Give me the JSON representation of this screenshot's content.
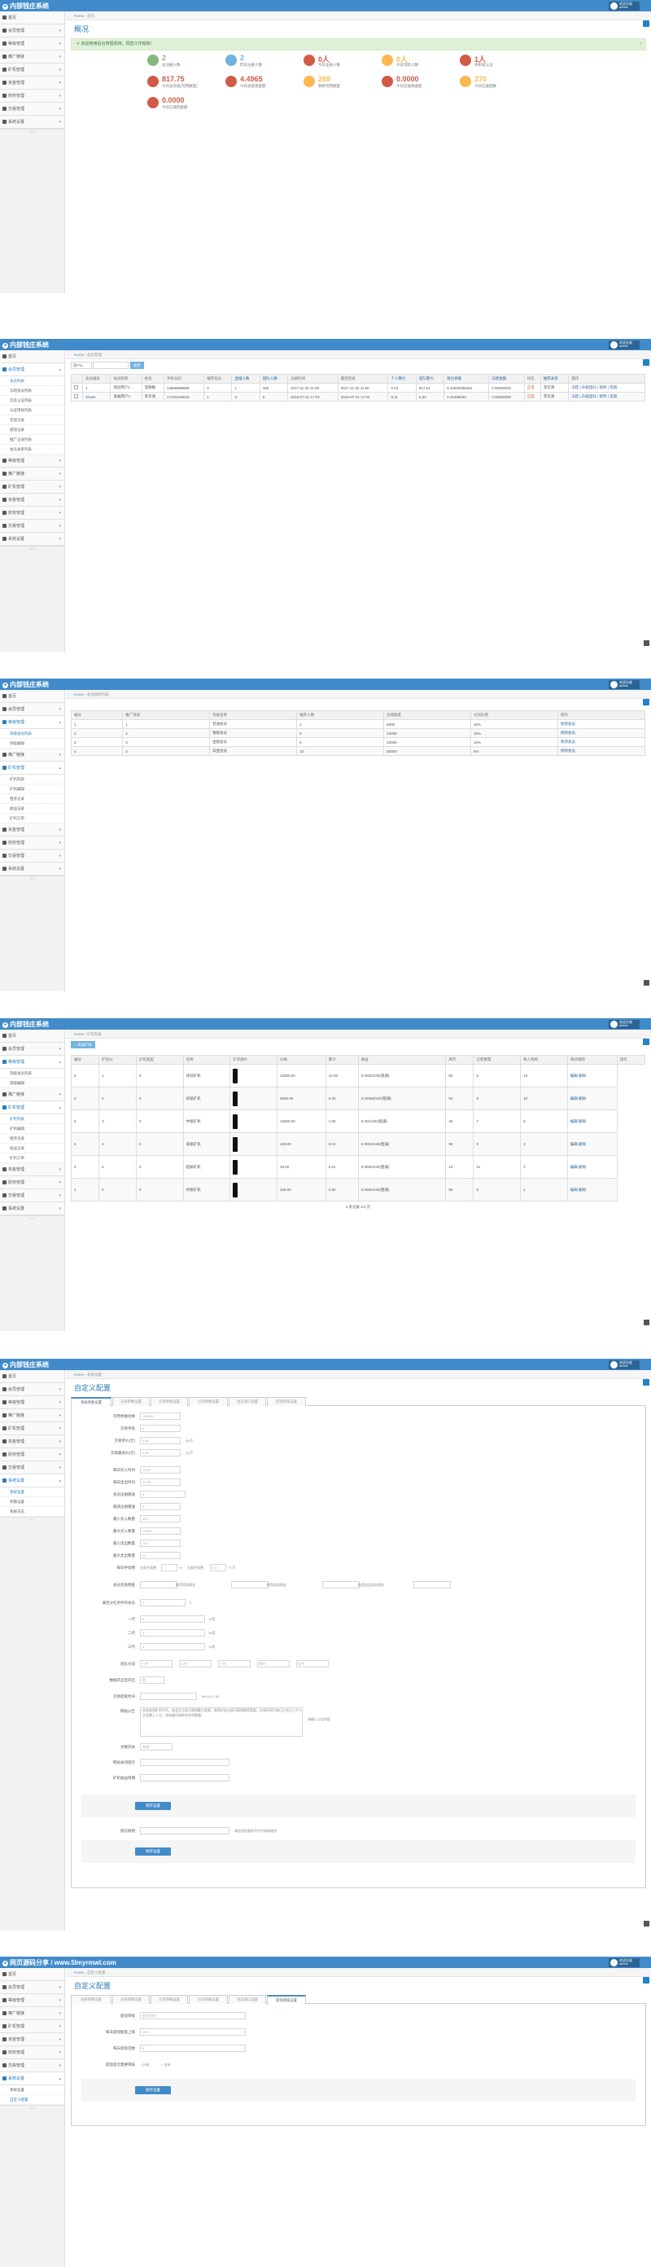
{
  "sys": {
    "title": "内部钱庄系统",
    "title_6": "网页源码分享 / www.5lmyrmwl.com",
    "user_line1": "欢迎光临",
    "user_line2": "admin",
    "collapse": "« »"
  },
  "crumb_home": "Home",
  "s1": {
    "crumb": "首页",
    "title": "概况",
    "alert": "欢迎使用后台管理系统，祝您工作愉快！",
    "stats": [
      {
        "value": "2",
        "label": "总注册人数",
        "color": "#87b87f"
      },
      {
        "value": "2",
        "label": "昨日注册人数",
        "color": "#6fb3e0"
      },
      {
        "value": "0人",
        "label": "今日注册人数",
        "color": "#d15b47"
      },
      {
        "value": "0人",
        "label": "今日活跃人数",
        "color": "#ffb752"
      },
      {
        "value": "1人",
        "label": "待审核认证",
        "color": "#d15b47"
      },
      {
        "value": "817.75",
        "label": "今日总充值(可用额度)",
        "color": "#d15b47"
      },
      {
        "value": "4.4965",
        "label": "今日总提现金额",
        "color": "#d15b47"
      },
      {
        "value": "269",
        "label": "剩余可用额度",
        "color": "#ffb752"
      },
      {
        "value": "0.0000",
        "label": "今日已放款金额",
        "color": "#d15b47"
      },
      {
        "value": "270",
        "label": "今日已收回数",
        "color": "#ffb752"
      },
      {
        "value": "0.0000",
        "label": "今日已收回金额",
        "color": "#d15b47"
      }
    ]
  },
  "s2": {
    "crumb": "会员管理",
    "select": "用户ID",
    "button": "搜索",
    "headers": [
      "会员编号",
      "会员昵称",
      "姓名",
      "手机号码",
      "推荐会员",
      "直推人数",
      "团队人数",
      "注册时间",
      "最后登录",
      "个人算力",
      "团队算力",
      "钱包余额",
      "冻结金额",
      "状态",
      "推荐关系",
      "操作"
    ],
    "rows": [
      [
        "1",
        "测试用户1",
        "李静静",
        "13888888888",
        "0",
        "1",
        "160",
        "2017-11-30 11:00",
        "2017-11-30 11:00",
        "0.22",
        "917.61",
        "9.10000366464",
        "0.00000000",
        "正常",
        "李华清",
        "冻结 | 升级团队 | 修改 | 充值"
      ],
      [
        "20164",
        "发展用户2",
        "李华清",
        "17193198040",
        "1",
        "0",
        "0",
        "2018-07-31 17:03",
        "2018-07-31 17:03",
        "0.11",
        "0.00",
        "4.30468003",
        "0.00000000",
        "正常",
        "李华清",
        "冻结 | 升级团队 | 修改 | 充值"
      ]
    ]
  },
  "s3": {
    "crumb": "会员级别列表",
    "headers": [
      "编号",
      "推广等级",
      "等级名称",
      "推荐人数",
      "业绩额度",
      "分润比例",
      "操作"
    ],
    "rows": [
      [
        "1",
        "1",
        "普通会员",
        "1",
        "5000",
        "20%",
        "修改会员"
      ],
      [
        "2",
        "2",
        "银级会员",
        "5",
        "10000",
        "15%",
        "修改会员"
      ],
      [
        "3",
        "3",
        "金级会员",
        "5",
        "10000",
        "10%",
        "修改会员"
      ],
      [
        "4",
        "4",
        "白金会员",
        "10",
        "50000",
        "5%",
        "修改会员"
      ]
    ]
  },
  "s4": {
    "crumb": "矿机列表",
    "add": "添加矿机",
    "headers": [
      "编号",
      "矿机ID",
      "矿机类型",
      "名称",
      "矿机图片",
      "价格",
      "算力",
      "收益",
      "库存",
      "已售数量",
      "每人限购",
      "每日限购",
      "操作"
    ],
    "rows": [
      [
        "8",
        "1",
        "0",
        "体验矿机",
        "",
        "10000.00",
        "10.00",
        "0.0002/24h(租满)",
        "60",
        "5",
        "10",
        "编辑 删除"
      ],
      [
        "6",
        "2",
        "0",
        "初级矿机",
        "",
        "5000.00",
        "5.00",
        "0.00058/24h(租满)",
        "54",
        "9",
        "10",
        "编辑 删除"
      ],
      [
        "5",
        "3",
        "0",
        "中级矿机",
        "",
        "10000.00",
        "1.00",
        "0.001/24h(租满)",
        "40",
        "7",
        "5",
        "编辑 删除"
      ],
      [
        "4",
        "4",
        "0",
        "高级矿机",
        "",
        "100.00",
        "0.10",
        "0.0002/24h(租满)",
        "90",
        "9",
        "3",
        "编辑 删除"
      ],
      [
        "3",
        "5",
        "0",
        "超级矿机",
        "",
        "10.00",
        "0.01",
        "0.0002/24h(租满)",
        "10",
        "11",
        "1",
        "编辑 删除"
      ],
      [
        "1",
        "6",
        "0",
        "终极矿机",
        "",
        "100.00",
        "0.80",
        "0.0002/24h(租满)",
        "98",
        "8",
        "1",
        "编辑 删除"
      ]
    ],
    "pager": "1 条记录 1/1 页"
  },
  "s5": {
    "crumb": "系统设置",
    "title": "自定义配置",
    "tabs": [
      "系统参数设置",
      "分销参数设置",
      "交易参数设置",
      "分润参数设置",
      "短信接口设置",
      "提现审核设置"
    ],
    "fields": [
      {
        "label": "可用余额兑换",
        "value": "100000"
      },
      {
        "label": "交易手续",
        "value": "5"
      },
      {
        "label": "交易单价(元)",
        "value": "0.85"
      },
      {
        "label": "交易最高价(元)",
        "value": "0.85"
      },
      {
        "label": "每日买入时间",
        "value": "10:00"
      },
      {
        "label": "每日卖出时间",
        "value": "22:00"
      },
      {
        "label": "会员注册赠送",
        "value": "0"
      },
      {
        "label": "邀请注册赠送",
        "value": "0"
      },
      {
        "label": "最小买入数量",
        "value": "100"
      },
      {
        "label": "最大买入数量",
        "value": "10000"
      },
      {
        "label": "最小卖出数量",
        "value": "100"
      },
      {
        "label": "最大卖出数量",
        "value": "10"
      }
    ],
    "unit_trade": "元/币",
    "fee_row": {
      "label": "每日手续费",
      "prefix": "交易手续费",
      "unit": "%",
      "mid": "交易手续费",
      "value": "0.5",
      "suffix": "个/币"
    },
    "quad_labels": [
      "会员充值佣金",
      "推荐奖励佣金",
      "推荐返现佣金",
      "推荐会员返利佣金"
    ],
    "level_row": {
      "label": "满足分红条件的会员",
      "value": "1",
      "unit": "人"
    },
    "gen_rows": [
      {
        "label": "一代",
        "value": "5",
        "unit": "%/奖"
      },
      {
        "label": "二代",
        "value": "3",
        "unit": "%/奖"
      },
      {
        "label": "三代",
        "value": "1",
        "unit": "%/奖"
      }
    ],
    "rate_label": "团队分润",
    "rates": [
      "一代",
      "二代",
      "三代",
      "四代",
      "五代"
    ],
    "switch_label": "数据开启后开启",
    "switch_value": "是",
    "time_label": "交易结束时间",
    "time_value": "08:00-17:00",
    "notice_label": "网站公告",
    "notice_text": "欢迎来到矿机平台，新会员注册可获得算力奖励，推荐好友注册可获得推荐奖励。交易时间为每日工作日上午十点至晚上十点，如有疑问请联系在线客服。",
    "notice_hint": "请输入公告内容",
    "more": [
      {
        "label": "兑换开关",
        "value": "关闭"
      },
      {
        "label": "网站关闭提示",
        "value": ""
      },
      {
        "label": "矿机收益周期",
        "value": ""
      }
    ],
    "submit": "保存设置",
    "key_label": "短信秘钥",
    "key_hint": "请在短信服务平台中获取秘钥",
    "submit2": "保存设置"
  },
  "s6": {
    "crumb": "自定义配置",
    "title": "自定义配置",
    "tabs": [
      "系统参数设置",
      "分销参数设置",
      "交易参数设置",
      "分润参数设置",
      "短信接口设置",
      "提现审核设置"
    ],
    "fields": [
      {
        "label": "提现审核",
        "value": "是否开启"
      },
      {
        "label": "每天提现额度上限",
        "value": "100"
      },
      {
        "label": "每天提现次数",
        "value": "5"
      }
    ],
    "radio_label": "提现是否需要审核",
    "radio_yes": "开启",
    "radio_no": "关闭",
    "submit": "保存设置"
  },
  "menu_main": [
    "首页",
    "会员管理",
    "等级管理",
    "推广链接",
    "矿机管理",
    "资金管理",
    "财务管理",
    "交易管理",
    "系统设置"
  ],
  "menu_s2_open": [
    "会员列表",
    "冻结会员列表",
    "实名认证列表",
    "认证审核列表",
    "充值记录",
    "提现记录",
    "推广记录列表",
    "会员关系列表"
  ],
  "menu_s3_sub": [
    "等级会员列表",
    "等级编辑"
  ],
  "menu_s4_sub": [
    "矿机列表",
    "矿机编辑"
  ],
  "menu_s4_sub2": [
    "租赁记录",
    "收益记录",
    "矿机订单"
  ],
  "menu_s5_sub": [
    "系统设置",
    "参数设置",
    "系统日志"
  ],
  "menu_s6_sub": [
    "系统设置",
    "自定义配置"
  ]
}
